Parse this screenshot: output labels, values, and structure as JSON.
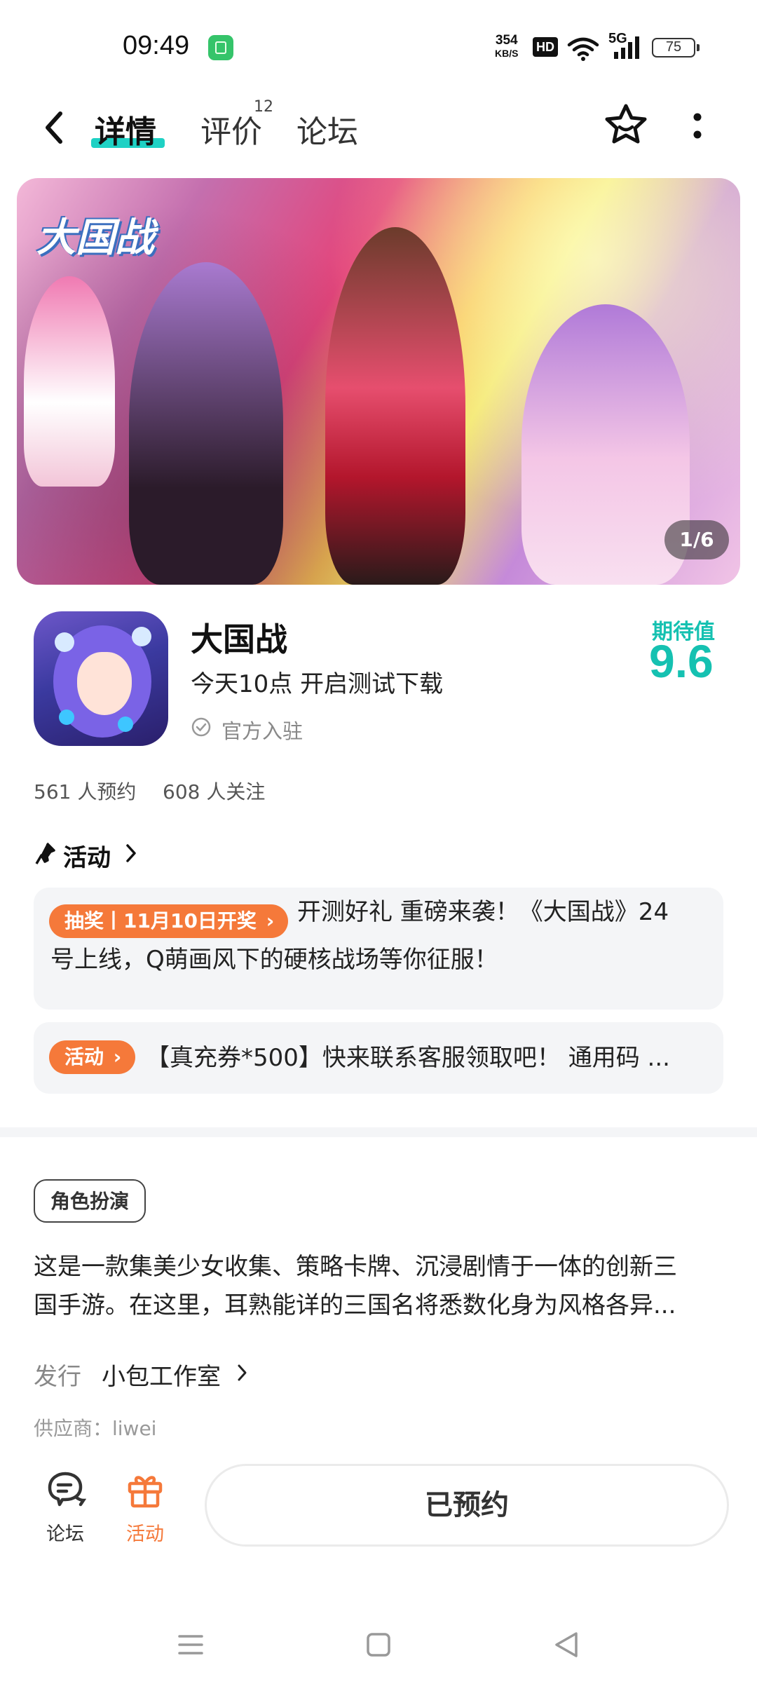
{
  "status_bar": {
    "time": "09:49",
    "net_speed_value": "354",
    "net_speed_unit": "KB/S",
    "hd": "HD",
    "network": "5G",
    "battery": "75"
  },
  "nav": {
    "tabs": [
      {
        "label": "详情",
        "active": true
      },
      {
        "label": "评价",
        "count": "12"
      },
      {
        "label": "论坛"
      }
    ]
  },
  "banner": {
    "logo_text": "大国战",
    "counter": "1/6"
  },
  "app": {
    "name": "大国战",
    "tagline": "今天10点 开启测试下载",
    "official": "官方入驻",
    "score_label": "期待值",
    "score": "9.6",
    "reservations": "561 人预约",
    "followers": "608 人关注"
  },
  "activities": {
    "title": "活动",
    "items": [
      {
        "badge": "抽奖丨11月10日开奖",
        "text_line1": "开测好礼 重磅来袭！《大国战》24",
        "text_line2": "号上线，Q萌画风下的硬核战场等你征服！"
      },
      {
        "badge": "活动",
        "text_line1": "【真充券*500】快来联系客服领取吧！ 通用码 ..."
      }
    ]
  },
  "details": {
    "genre_tag": "角色扮演",
    "description_line1": "这是一款集美少女收集、策略卡牌、沉浸剧情于一体的创新三",
    "description_line2": "国手游。在这里，耳熟能详的三国名将悉数化身为风格各异...",
    "publisher_label": "发行",
    "publisher_name": "小包工作室",
    "supplier": "供应商：liwei"
  },
  "bottom_bar": {
    "forum_label": "论坛",
    "event_label": "活动",
    "reserved_label": "已预约"
  },
  "colors": {
    "accent_teal": "#15c1b1",
    "accent_orange": "#f5793a"
  }
}
